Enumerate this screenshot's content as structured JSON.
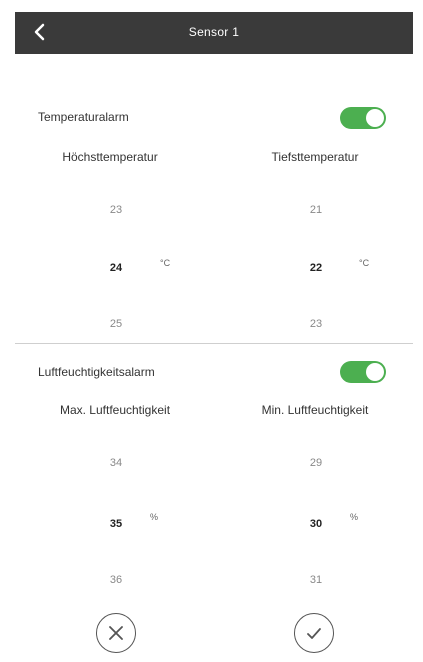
{
  "header": {
    "title": "Sensor 1",
    "back_icon": "chevron-left-icon"
  },
  "temperature": {
    "alarm_label": "Temperaturalarm",
    "alarm_enabled": true,
    "max": {
      "label": "Höchsttemperatur",
      "values": [
        "23",
        "24",
        "25"
      ],
      "selected": "24",
      "unit": "°C"
    },
    "min": {
      "label": "Tiefsttemperatur",
      "values": [
        "21",
        "22",
        "23"
      ],
      "selected": "22",
      "unit": "°C"
    }
  },
  "humidity": {
    "alarm_label": "Luftfeuchtigkeitsalarm",
    "alarm_enabled": true,
    "max": {
      "label": "Max. Luftfeuchtigkeit",
      "values": [
        "34",
        "35",
        "36"
      ],
      "selected": "35",
      "unit": "%"
    },
    "min": {
      "label": "Min. Luftfeuchtigkeit",
      "values": [
        "29",
        "30",
        "31"
      ],
      "selected": "30",
      "unit": "%"
    }
  },
  "actions": {
    "cancel_icon": "close-circle-icon",
    "confirm_icon": "check-circle-icon"
  },
  "colors": {
    "header_bg": "#3a3a3a",
    "toggle_on": "#4caf50"
  }
}
